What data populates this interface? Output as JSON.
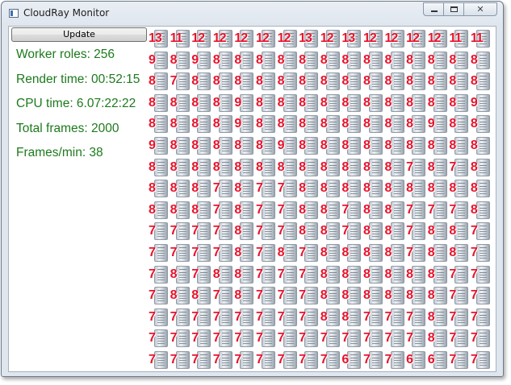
{
  "window": {
    "title": "CloudRay Monitor"
  },
  "toolbar": {
    "update_label": "Update"
  },
  "stats": [
    "Worker roles: 256",
    "Render time: 00:52:15",
    "CPU time: 6.07:22:22",
    "Total frames: 2000",
    "Frames/min: 38"
  ],
  "workers": {
    "icon": "server-icon",
    "text_color": "#e8132b",
    "frame_counts": [
      [
        13,
        11,
        12,
        12,
        12,
        12,
        12,
        13,
        12,
        13,
        12,
        12,
        12,
        12,
        11,
        11
      ],
      [
        9,
        8,
        9,
        8,
        8,
        8,
        8,
        8,
        8,
        8,
        8,
        8,
        8,
        8,
        8,
        8
      ],
      [
        8,
        7,
        8,
        8,
        8,
        8,
        8,
        8,
        8,
        8,
        8,
        8,
        8,
        8,
        8,
        8
      ],
      [
        8,
        8,
        8,
        8,
        9,
        8,
        8,
        8,
        8,
        8,
        8,
        8,
        8,
        8,
        8,
        9
      ],
      [
        8,
        8,
        8,
        8,
        9,
        8,
        8,
        8,
        8,
        8,
        8,
        8,
        8,
        9,
        8,
        8
      ],
      [
        9,
        8,
        8,
        8,
        8,
        8,
        9,
        8,
        8,
        8,
        8,
        8,
        8,
        8,
        8,
        8
      ],
      [
        8,
        8,
        8,
        8,
        8,
        8,
        8,
        8,
        8,
        8,
        8,
        8,
        7,
        8,
        7,
        8
      ],
      [
        8,
        8,
        8,
        7,
        8,
        7,
        7,
        8,
        8,
        8,
        8,
        8,
        8,
        8,
        8,
        8
      ],
      [
        8,
        8,
        8,
        7,
        8,
        7,
        7,
        8,
        8,
        7,
        8,
        8,
        7,
        7,
        7,
        8
      ],
      [
        7,
        7,
        7,
        7,
        8,
        7,
        7,
        8,
        8,
        7,
        8,
        8,
        7,
        8,
        8,
        7
      ],
      [
        7,
        7,
        7,
        7,
        8,
        7,
        8,
        7,
        8,
        8,
        8,
        8,
        7,
        8,
        8,
        7
      ],
      [
        7,
        8,
        7,
        8,
        8,
        7,
        7,
        7,
        8,
        8,
        8,
        8,
        8,
        8,
        7,
        7
      ],
      [
        7,
        8,
        8,
        7,
        8,
        7,
        7,
        7,
        8,
        8,
        8,
        8,
        8,
        8,
        7,
        7
      ],
      [
        7,
        7,
        7,
        7,
        7,
        7,
        7,
        7,
        8,
        8,
        7,
        7,
        7,
        8,
        7,
        7
      ],
      [
        7,
        7,
        7,
        7,
        7,
        7,
        7,
        7,
        7,
        7,
        7,
        7,
        7,
        8,
        7,
        7
      ],
      [
        7,
        7,
        7,
        7,
        7,
        7,
        7,
        7,
        7,
        6,
        7,
        7,
        6,
        6,
        7,
        7
      ]
    ]
  }
}
